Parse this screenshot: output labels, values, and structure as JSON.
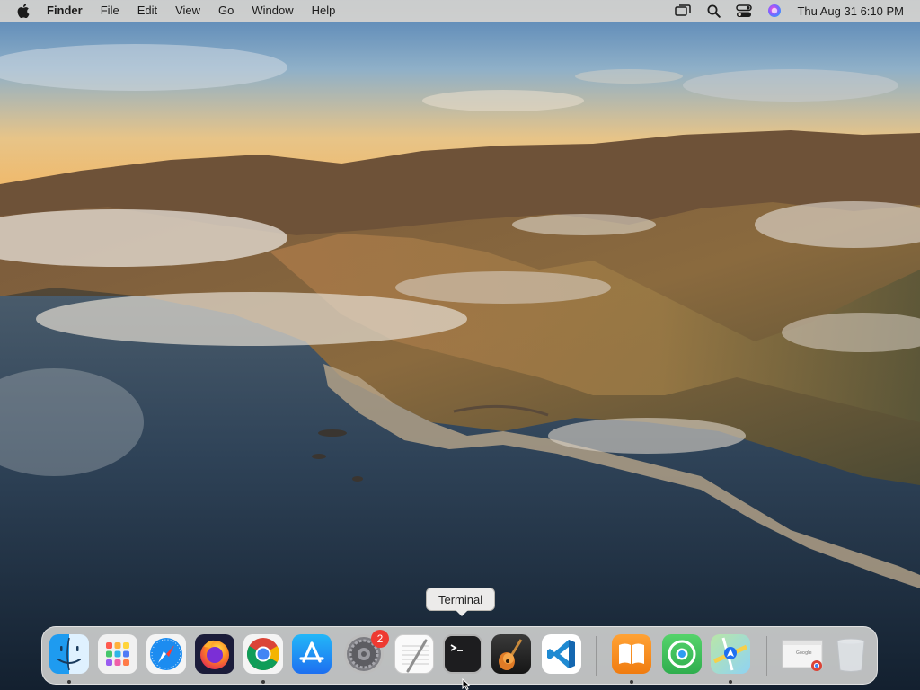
{
  "menubar": {
    "app_name": "Finder",
    "items": [
      "File",
      "Edit",
      "View",
      "Go",
      "Window",
      "Help"
    ],
    "status_icons": [
      "screen-mirroring-icon",
      "search-icon",
      "control-center-icon",
      "siri-icon"
    ],
    "clock": "Thu Aug 31  6:10 PM"
  },
  "tooltip": {
    "label": "Terminal"
  },
  "dock": {
    "apps": [
      {
        "name": "Finder",
        "icon": "finder-icon",
        "running": true
      },
      {
        "name": "Launchpad",
        "icon": "launchpad-icon",
        "running": false
      },
      {
        "name": "Safari",
        "icon": "safari-icon",
        "running": false
      },
      {
        "name": "Firefox",
        "icon": "firefox-icon",
        "running": false
      },
      {
        "name": "Google Chrome",
        "icon": "chrome-icon",
        "running": true
      },
      {
        "name": "App Store",
        "icon": "app-store-icon",
        "running": false
      },
      {
        "name": "System Preferences",
        "icon": "system-preferences-icon",
        "running": false,
        "badge": "2"
      },
      {
        "name": "TextEdit",
        "icon": "textedit-icon",
        "running": false
      },
      {
        "name": "Terminal",
        "icon": "terminal-icon",
        "running": false
      },
      {
        "name": "GarageBand",
        "icon": "garageband-icon",
        "running": false
      },
      {
        "name": "Visual Studio Code",
        "icon": "vscode-icon",
        "running": false
      },
      {
        "name": "Books",
        "icon": "books-icon",
        "running": true
      },
      {
        "name": "Find My",
        "icon": "find-my-icon",
        "running": false
      },
      {
        "name": "Maps",
        "icon": "maps-icon",
        "running": true
      },
      {
        "name": "Chrome document",
        "icon": "chrome-document-icon",
        "running": false
      },
      {
        "name": "Trash",
        "icon": "trash-icon",
        "running": false
      }
    ],
    "badge": "2"
  },
  "colors": {
    "menubar_bg": "#dcd7d0",
    "dock_bg": "#eceae7",
    "badge": "#ee3a32"
  }
}
